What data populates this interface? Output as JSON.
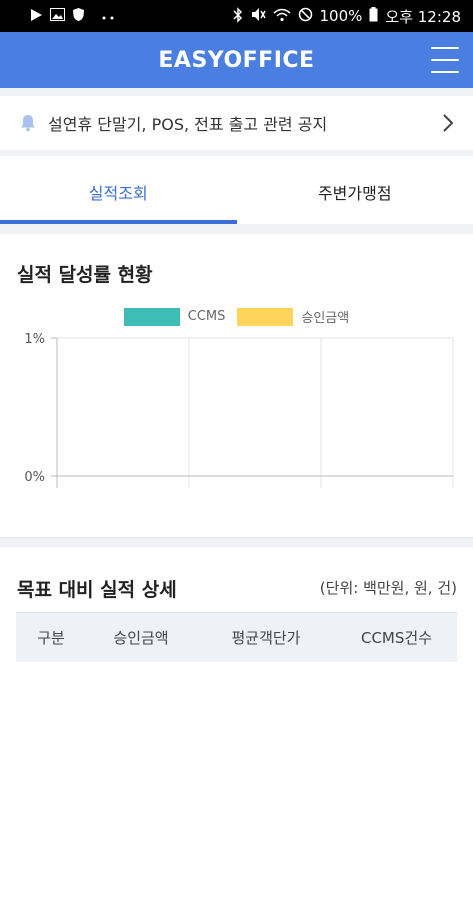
{
  "status_bar": {
    "left_icons": [
      "play-icon",
      "gallery-icon",
      "shield-icon",
      "more-dots-icon"
    ],
    "right_icons": [
      "bluetooth-icon",
      "mute-icon",
      "wifi-icon",
      "no-disturb-icon"
    ],
    "battery": "100%",
    "time": "오후 12:28"
  },
  "header": {
    "title": "EASYOFFICE",
    "menu_icon": "hamburger-menu-icon"
  },
  "notice": {
    "icon": "bell-icon",
    "text": "설연휴 단말기, POS, 전표 출고 관련 공지",
    "chevron_icon": "chevron-right-icon"
  },
  "tabs": [
    {
      "label": "실적조회",
      "active": true
    },
    {
      "label": "주변가맹점",
      "active": false
    }
  ],
  "performance": {
    "title": "실적 달성률 현황"
  },
  "chart_data": {
    "type": "bar",
    "categories": [
      "",
      "",
      ""
    ],
    "series": [
      {
        "name": "CCMS",
        "values": [
          0,
          0,
          0
        ],
        "color": "#3dbdb6"
      },
      {
        "name": "승인금액",
        "values": [
          0,
          0,
          0
        ],
        "color": "#ffd45a"
      }
    ],
    "yticks": [
      "1%",
      "0%"
    ],
    "ylim": [
      0,
      1
    ],
    "grid": true,
    "legend": "top-center"
  },
  "detail": {
    "title": "목표 대비 실적 상세",
    "unit_note": "(단위: 백만원, 원, 건)",
    "columns": [
      "구분",
      "승인금액",
      "평균객단가",
      "CCMS건수"
    ]
  }
}
